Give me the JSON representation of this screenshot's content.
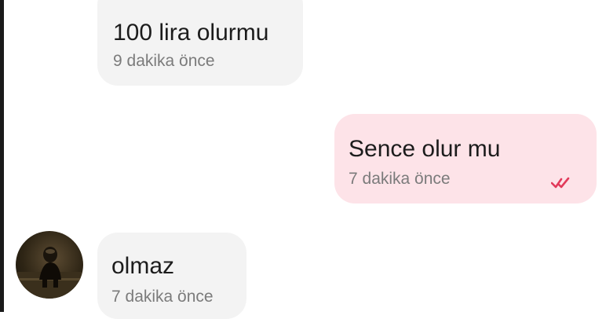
{
  "messages": [
    {
      "direction": "incoming",
      "text": "100 lira olurmu",
      "time": "9 dakika önce"
    },
    {
      "direction": "outgoing",
      "text": "Sence olur mu",
      "time": "7 dakika önce",
      "status_icon": "double-check-icon",
      "status_color": "#e23a5a"
    },
    {
      "direction": "incoming",
      "text": "olmaz",
      "time": "7 dakika önce",
      "has_avatar": true
    }
  ],
  "colors": {
    "incoming_bubble": "#f3f3f3",
    "outgoing_bubble": "#fde3e8",
    "text": "#1c1c1c",
    "timestamp": "#7b7b7b"
  }
}
